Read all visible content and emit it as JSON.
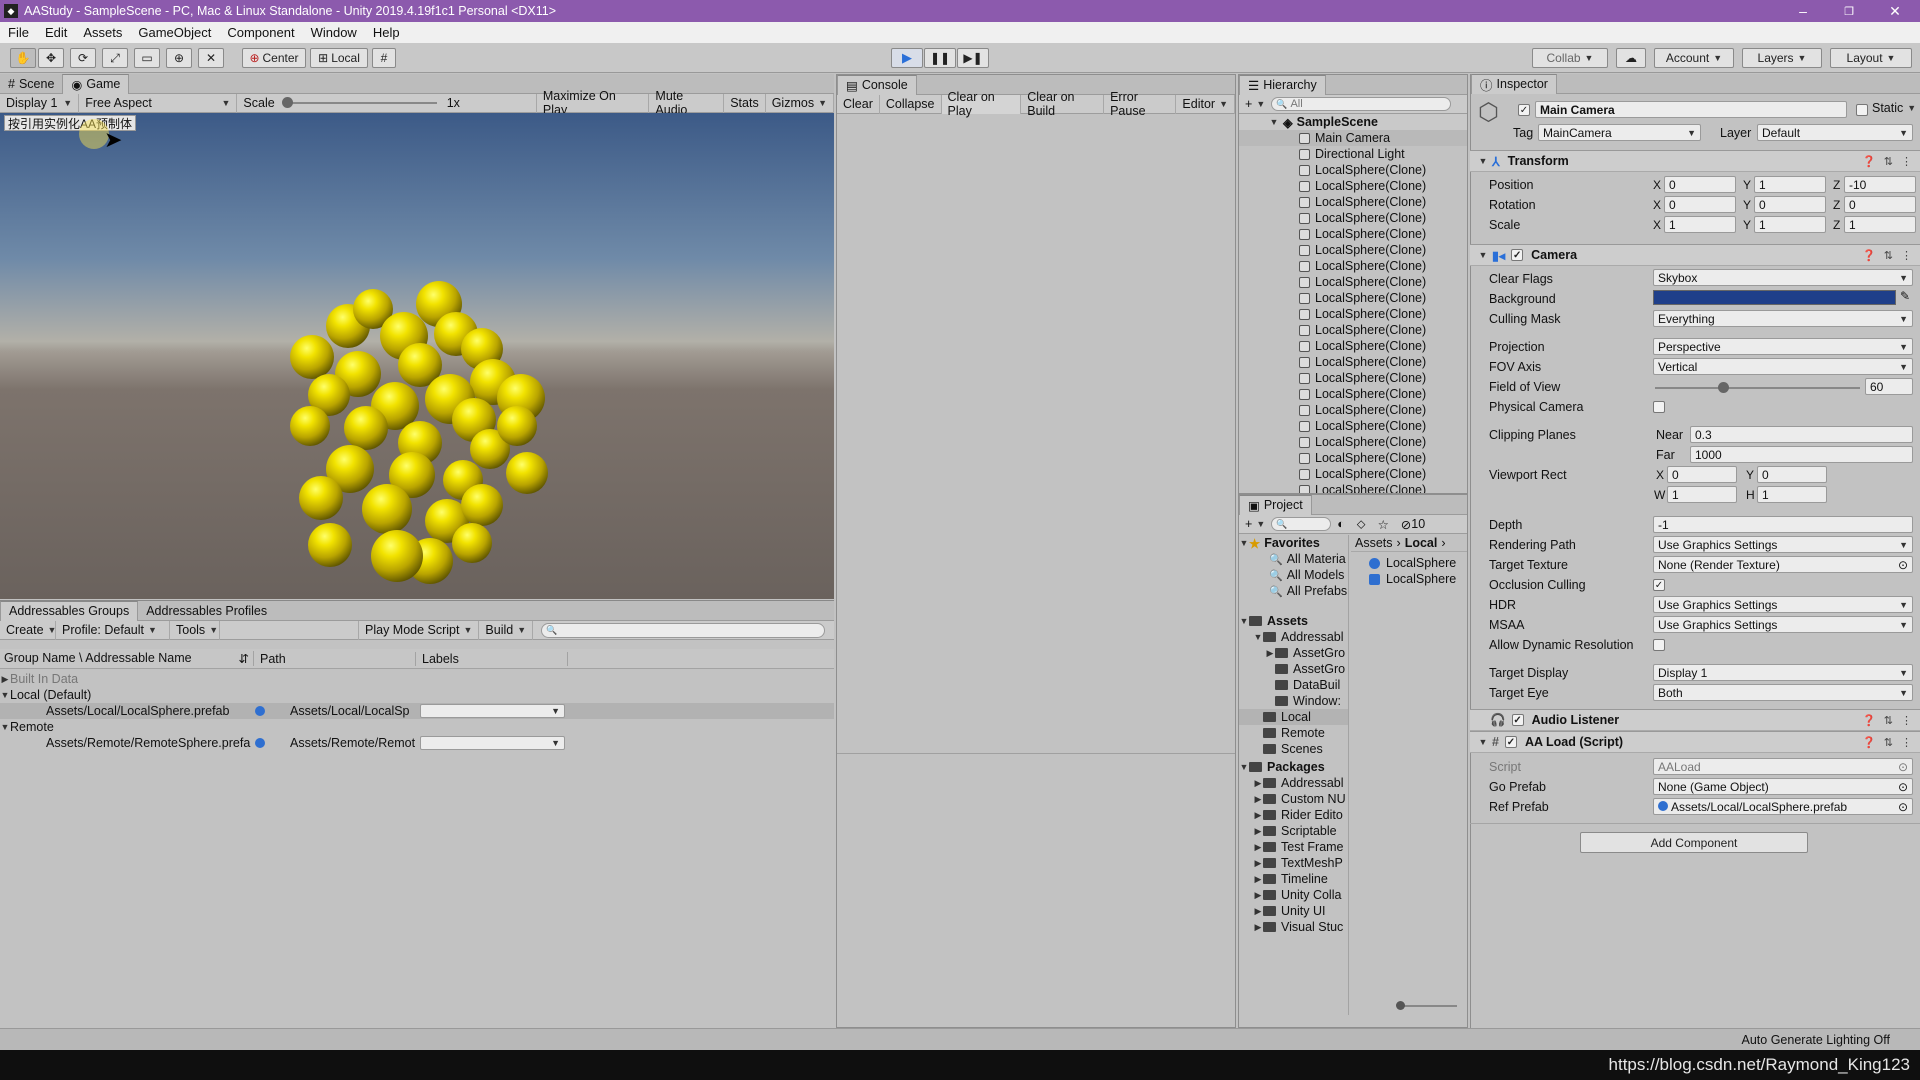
{
  "window": {
    "title": "AAStudy - SampleScene - PC, Mac & Linux Standalone - Unity 2019.4.19f1c1 Personal <DX11>",
    "minimize": "–",
    "maximize": "❐",
    "close": "✕"
  },
  "menu": [
    "File",
    "Edit",
    "Assets",
    "GameObject",
    "Component",
    "Window",
    "Help"
  ],
  "toolbar": {
    "pivot": "Center",
    "space": "Local",
    "collab": "Collab",
    "account": "Account",
    "layers": "Layers",
    "layout": "Layout"
  },
  "game_view": {
    "tabs": [
      "Scene",
      "Game"
    ],
    "display": "Display 1",
    "aspect": "Free Aspect",
    "scale_label": "Scale",
    "scale_value": "1x",
    "buttons": [
      "Maximize On Play",
      "Mute Audio",
      "Stats",
      "Gizmos"
    ],
    "overlay_button": "按引用实例化AA预制体"
  },
  "addressables": {
    "tabs": [
      "Addressables Groups",
      "Addressables Profiles"
    ],
    "create": "Create",
    "profile": "Profile: Default",
    "tools": "Tools",
    "play_mode": "Play Mode Script",
    "build": "Build",
    "columns": [
      "Group Name \\ Addressable Name",
      "Path",
      "Labels"
    ],
    "groups": [
      {
        "name": "Built In Data",
        "entries": []
      },
      {
        "name": "Local (Default)",
        "entries": [
          {
            "name": "Assets/Local/LocalSphere.prefab",
            "path": "Assets/Local/LocalSp"
          }
        ]
      },
      {
        "name": "Remote",
        "entries": [
          {
            "name": "Assets/Remote/RemoteSphere.prefa",
            "path": "Assets/Remote/Remot"
          }
        ]
      }
    ]
  },
  "console": {
    "tab": "Console",
    "buttons": [
      "Clear",
      "Collapse",
      "Clear on Play",
      "Clear on Build",
      "Error Pause",
      "Editor"
    ]
  },
  "hierarchy": {
    "tab": "Hierarchy",
    "search_placeholder": "All",
    "scene": "SampleScene",
    "items": [
      "Main Camera",
      "Directional Light",
      "LocalSphere(Clone)",
      "LocalSphere(Clone)",
      "LocalSphere(Clone)",
      "LocalSphere(Clone)",
      "LocalSphere(Clone)",
      "LocalSphere(Clone)",
      "LocalSphere(Clone)",
      "LocalSphere(Clone)",
      "LocalSphere(Clone)",
      "LocalSphere(Clone)",
      "LocalSphere(Clone)",
      "LocalSphere(Clone)",
      "LocalSphere(Clone)",
      "LocalSphere(Clone)",
      "LocalSphere(Clone)",
      "LocalSphere(Clone)",
      "LocalSphere(Clone)",
      "LocalSphere(Clone)",
      "LocalSphere(Clone)",
      "LocalSphere(Clone)",
      "LocalSphere(Clone)"
    ]
  },
  "project": {
    "tab": "Project",
    "hidden_count": "10",
    "favorites": {
      "label": "Favorites",
      "items": [
        "All Materia",
        "All Models",
        "All Prefabs"
      ]
    },
    "assets": {
      "label": "Assets",
      "items": [
        "Addressabl",
        "AssetGro",
        "AssetGro",
        "DataBuil",
        "Window:",
        "Local",
        "Remote",
        "Scenes"
      ]
    },
    "packages": {
      "label": "Packages",
      "items": [
        "Addressabl",
        "Custom NU",
        "Rider Edito",
        "Scriptable",
        "Test Frame",
        "TextMeshP",
        "Timeline",
        "Unity Colla",
        "Unity UI",
        "Visual Stuc"
      ]
    },
    "breadcrumb": [
      "Assets",
      "Local"
    ],
    "files": [
      "LocalSphere",
      "LocalSphere"
    ]
  },
  "inspector": {
    "tab": "Inspector",
    "object_name": "Main Camera",
    "static_label": "Static",
    "tag_label": "Tag",
    "tag": "MainCamera",
    "layer_label": "Layer",
    "layer": "Default",
    "transform": {
      "title": "Transform",
      "rows": [
        {
          "label": "Position",
          "x": "0",
          "y": "1",
          "z": "-10"
        },
        {
          "label": "Rotation",
          "x": "0",
          "y": "0",
          "z": "0"
        },
        {
          "label": "Scale",
          "x": "1",
          "y": "1",
          "z": "1"
        }
      ]
    },
    "camera": {
      "title": "Camera",
      "clear_flags": {
        "label": "Clear Flags",
        "value": "Skybox"
      },
      "background": {
        "label": "Background",
        "color": "#1f3f8a"
      },
      "culling_mask": {
        "label": "Culling Mask",
        "value": "Everything"
      },
      "projection": {
        "label": "Projection",
        "value": "Perspective"
      },
      "fov_axis": {
        "label": "FOV Axis",
        "value": "Vertical"
      },
      "fov": {
        "label": "Field of View",
        "value": "60",
        "fraction": 0.33
      },
      "physical_camera": {
        "label": "Physical Camera"
      },
      "clipping": {
        "label": "Clipping Planes",
        "near_label": "Near",
        "near": "0.3",
        "far_label": "Far",
        "far": "1000"
      },
      "viewport": {
        "label": "Viewport Rect",
        "x": "0",
        "y": "0",
        "w": "1",
        "h": "1"
      },
      "depth": {
        "label": "Depth",
        "value": "-1"
      },
      "rendering_path": {
        "label": "Rendering Path",
        "value": "Use Graphics Settings"
      },
      "target_texture": {
        "label": "Target Texture",
        "value": "None (Render Texture)"
      },
      "occlusion": {
        "label": "Occlusion Culling"
      },
      "hdr": {
        "label": "HDR",
        "value": "Use Graphics Settings"
      },
      "msaa": {
        "label": "MSAA",
        "value": "Use Graphics Settings"
      },
      "dynamic_res": {
        "label": "Allow Dynamic Resolution"
      },
      "target_display": {
        "label": "Target Display",
        "value": "Display 1"
      },
      "target_eye": {
        "label": "Target Eye",
        "value": "Both"
      }
    },
    "audio_listener": "Audio Listener",
    "aa_load": {
      "title": "AA Load (Script)",
      "script_label": "Script",
      "script": "AALoad",
      "go_label": "Go Prefab",
      "go": "None (Game Object)",
      "ref_label": "Ref Prefab",
      "ref": "Assets/Local/LocalSphere.prefab"
    },
    "add_component": "Add Component"
  },
  "status": {
    "lighting": "Auto Generate Lighting Off",
    "watermark": "https://blog.csdn.net/Raymond_King123"
  }
}
